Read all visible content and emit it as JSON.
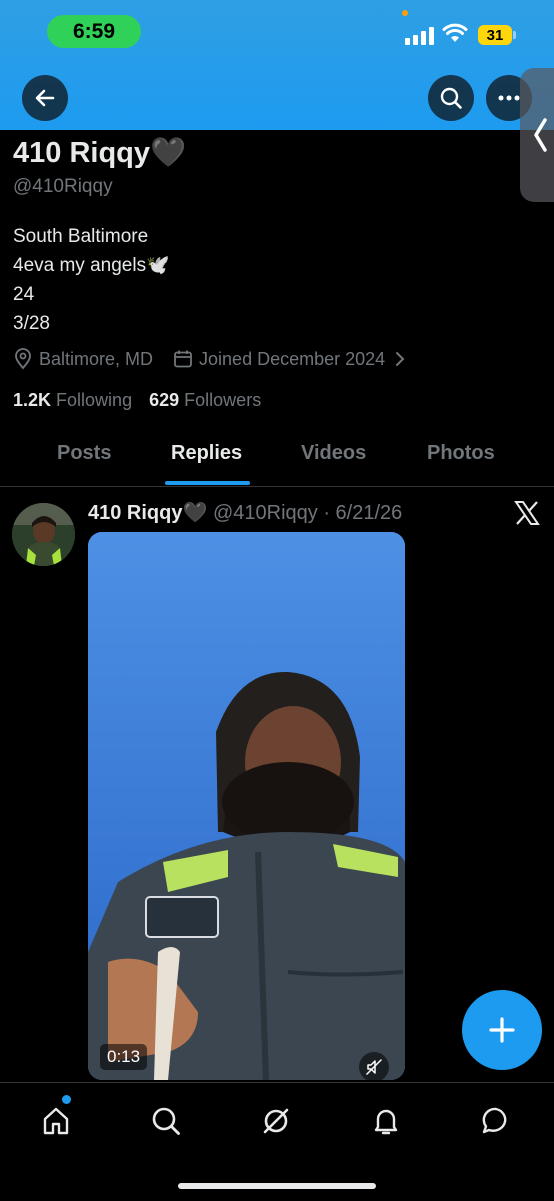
{
  "status_bar": {
    "time": "6:59",
    "battery": "31"
  },
  "profile": {
    "name": "410 Riqqy🖤",
    "handle": "@410Riqqy",
    "bio_lines": [
      "South Baltimore",
      "4eva my angels🕊️",
      "24",
      "3/28"
    ],
    "location": "Baltimore, MD",
    "joined": "Joined December 2024",
    "following_count": "1.2K",
    "following_label": "Following",
    "followers_count": "629",
    "followers_label": "Followers"
  },
  "tabs": [
    {
      "label": "Posts"
    },
    {
      "label": "Replies"
    },
    {
      "label": "Videos"
    },
    {
      "label": "Photos"
    }
  ],
  "active_tab": "Replies",
  "post": {
    "author_name": "410 Riqqy🖤",
    "author_handle": "@410Riqqy",
    "date": "6/21/26",
    "video_duration": "0:13"
  },
  "icons": {
    "back": "arrow-left-icon",
    "search": "search-icon",
    "more": "more-icon",
    "location": "location-pin-icon",
    "calendar": "calendar-icon",
    "compose": "plus-icon",
    "mute": "mute-icon"
  },
  "colors": {
    "accent": "#1d9bf0",
    "banner": "#2f9fe3",
    "background": "#000000"
  }
}
